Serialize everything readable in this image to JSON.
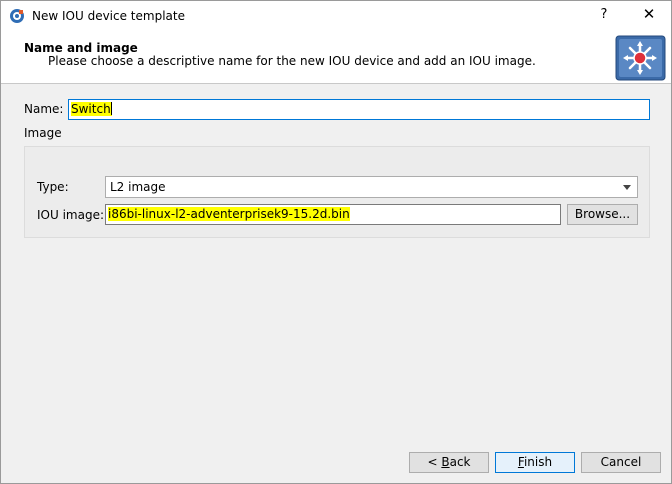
{
  "window": {
    "title": "New IOU device template",
    "help_label": "?",
    "close_label": "✕"
  },
  "header": {
    "title": "Name and image",
    "subtitle": "Please choose a descriptive name for the new IOU device and add an IOU image."
  },
  "form": {
    "name_label": "Name:",
    "name_value": "Switch",
    "image_group_label": "Image",
    "type_label": "Type:",
    "type_value": "L2 image",
    "iou_image_label": "IOU image:",
    "iou_image_value": "i86bi-linux-l2-adventerprisek9-15.2d.bin",
    "browse_label": "Browse..."
  },
  "footer": {
    "back_mnemonic": "B",
    "back_rest": "ack",
    "back_prefix": "< ",
    "finish_mnemonic": "F",
    "finish_rest": "inish",
    "cancel_label": "Cancel"
  },
  "colors": {
    "highlight": "#ffff00",
    "focus_border": "#0078d7",
    "header_icon_bg": "#3b6aa8",
    "header_icon_dot": "#e0303a"
  }
}
